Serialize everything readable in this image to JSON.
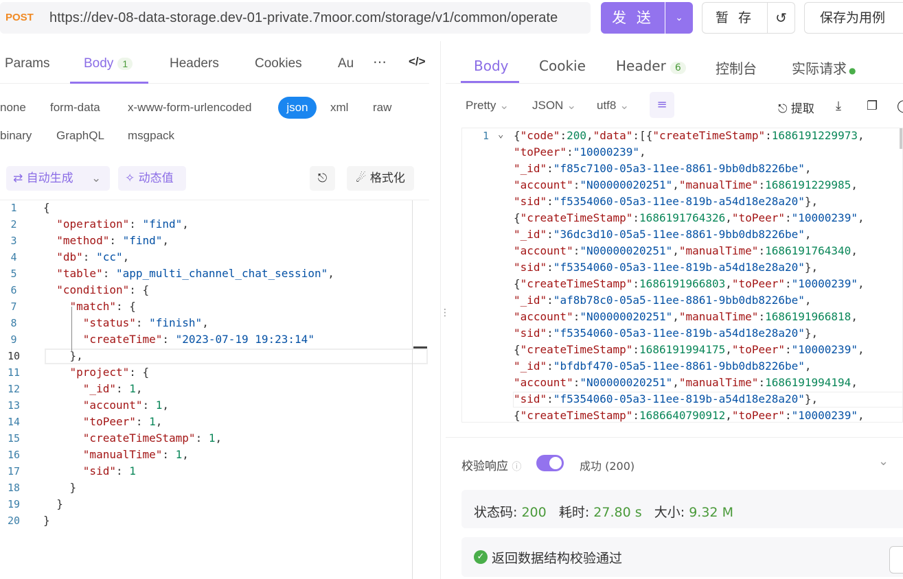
{
  "request": {
    "method": "POST",
    "url": "https://dev-08-data-storage.dev-01-private.7moor.com/storage/v1/common/operate",
    "send_label": "发 送",
    "save_label": "暂 存",
    "save_case_label": "保存为用例"
  },
  "left_tabs": [
    {
      "label": "Params"
    },
    {
      "label": "Body",
      "badge": "1"
    },
    {
      "label": "Headers"
    },
    {
      "label": "Cookies"
    },
    {
      "label": "Au"
    }
  ],
  "body_types": [
    "none",
    "form-data",
    "x-www-form-urlencoded",
    "json",
    "xml",
    "raw",
    "binary",
    "GraphQL",
    "msgpack"
  ],
  "selected_body_type": "json",
  "editor_toolbar": {
    "auto_generate": "自动生成",
    "dynamic_value": "动态值",
    "format": "格式化"
  },
  "editor_lines": [
    {
      "no": "1",
      "text": "{"
    },
    {
      "no": "2",
      "text": "  \"operation\": \"find\","
    },
    {
      "no": "3",
      "text": "  \"method\": \"find\","
    },
    {
      "no": "4",
      "text": "  \"db\": \"cc\","
    },
    {
      "no": "5",
      "text": "  \"table\": \"app_multi_channel_chat_session\","
    },
    {
      "no": "6",
      "text": "  \"condition\": {"
    },
    {
      "no": "7",
      "text": "    \"match\": {"
    },
    {
      "no": "8",
      "text": "      \"status\": \"finish\","
    },
    {
      "no": "9",
      "text": "      \"createTime\": \"2023-07-19 19:23:14\""
    },
    {
      "no": "10",
      "text": "    },"
    },
    {
      "no": "11",
      "text": "    \"project\": {"
    },
    {
      "no": "12",
      "text": "      \"_id\": 1,"
    },
    {
      "no": "13",
      "text": "      \"account\": 1,"
    },
    {
      "no": "14",
      "text": "      \"toPeer\": 1,"
    },
    {
      "no": "15",
      "text": "      \"createTimeStamp\": 1,"
    },
    {
      "no": "16",
      "text": "      \"manualTime\": 1,"
    },
    {
      "no": "17",
      "text": "      \"sid\": 1"
    },
    {
      "no": "18",
      "text": "    }"
    },
    {
      "no": "19",
      "text": "  }"
    },
    {
      "no": "20",
      "text": "}"
    }
  ],
  "right_tabs": [
    {
      "label": "Body"
    },
    {
      "label": "Cookie"
    },
    {
      "label": "Header",
      "badge": "6"
    },
    {
      "label": "控制台"
    },
    {
      "label": "实际请求"
    }
  ],
  "response_options": {
    "view": "Pretty",
    "format": "JSON",
    "encoding": "utf8",
    "extract": "提取"
  },
  "response_line_no": "1",
  "response_lines": [
    "{\"code\":200,\"data\":[{\"createTimeStamp\":1686191229973,",
    "\"toPeer\":\"10000239\",",
    "\"_id\":\"f85c7100-05a3-11ee-8861-9bb0db8226be\",",
    "\"account\":\"N00000020251\",\"manualTime\":1686191229985,",
    "\"sid\":\"f5354060-05a3-11ee-819b-a54d18e28a20\"},",
    "{\"createTimeStamp\":1686191764326,\"toPeer\":\"10000239\",",
    "\"_id\":\"36dc3d10-05a5-11ee-8861-9bb0db8226be\",",
    "\"account\":\"N00000020251\",\"manualTime\":1686191764340,",
    "\"sid\":\"f5354060-05a3-11ee-819b-a54d18e28a20\"},",
    "{\"createTimeStamp\":1686191966803,\"toPeer\":\"10000239\",",
    "\"_id\":\"af8b78c0-05a5-11ee-8861-9bb0db8226be\",",
    "\"account\":\"N00000020251\",\"manualTime\":1686191966818,",
    "\"sid\":\"f5354060-05a3-11ee-819b-a54d18e28a20\"},",
    "{\"createTimeStamp\":1686191994175,\"toPeer\":\"10000239\",",
    "\"_id\":\"bfdbf470-05a5-11ee-8861-9bb0db8226be\",",
    "\"account\":\"N00000020251\",\"manualTime\":1686191994194,",
    "\"sid\":\"f5354060-05a3-11ee-819b-a54d18e28a20\"},",
    "{\"createTimeStamp\":1686640790912,\"toPeer\":\"10000239\","
  ],
  "validation": {
    "label": "校验响应",
    "result": "成功 (200)",
    "status_label": "状态码:",
    "status_value": "200",
    "time_label": "耗时:",
    "time_value": "27.80 s",
    "size_label": "大小:",
    "size_value": "9.32 M",
    "check_message": "返回数据结构校验通过"
  },
  "colors": {
    "accent": "#9373ee",
    "json_pill": "#1a86f0",
    "success": "#4a9a3a",
    "method": "#f08a24"
  }
}
